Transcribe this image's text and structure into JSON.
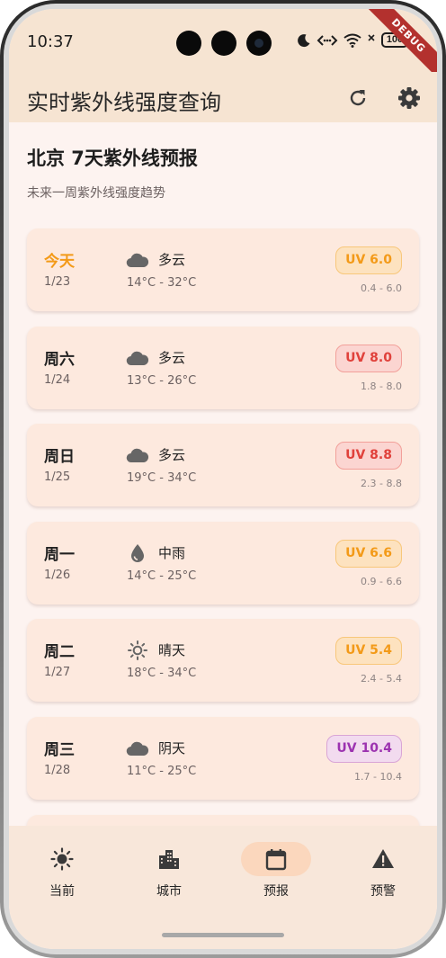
{
  "status_bar": {
    "time": "10:37",
    "battery": "100",
    "debug_label": "DEBUG"
  },
  "app_bar": {
    "title": "实时紫外线强度查询",
    "refresh_icon": "refresh-icon",
    "settings_icon": "gear-icon"
  },
  "forecast": {
    "title": "北京 7天紫外线预报",
    "subtitle": "未来一周紫外线强度趋势",
    "days": [
      {
        "day": "今天",
        "date": "1/23",
        "icon": "cloud-icon",
        "weather": "多云",
        "temp": "14°C - 32°C",
        "uv": "UV 6.0",
        "range": "0.4 - 6.0",
        "level": "high"
      },
      {
        "day": "周六",
        "date": "1/24",
        "icon": "cloud-icon",
        "weather": "多云",
        "temp": "13°C - 26°C",
        "uv": "UV 8.0",
        "range": "1.8 - 8.0",
        "level": "very-high"
      },
      {
        "day": "周日",
        "date": "1/25",
        "icon": "cloud-icon",
        "weather": "多云",
        "temp": "19°C - 34°C",
        "uv": "UV 8.8",
        "range": "2.3 - 8.8",
        "level": "very-high"
      },
      {
        "day": "周一",
        "date": "1/26",
        "icon": "rain-drop-icon",
        "weather": "中雨",
        "temp": "14°C - 25°C",
        "uv": "UV 6.6",
        "range": "0.9 - 6.6",
        "level": "high"
      },
      {
        "day": "周二",
        "date": "1/27",
        "icon": "sun-icon",
        "weather": "晴天",
        "temp": "18°C - 34°C",
        "uv": "UV 5.4",
        "range": "2.4 - 5.4",
        "level": "high"
      },
      {
        "day": "周三",
        "date": "1/28",
        "icon": "cloud-icon",
        "weather": "阴天",
        "temp": "11°C - 25°C",
        "uv": "UV 10.4",
        "range": "1.7 - 10.4",
        "level": "extreme"
      }
    ]
  },
  "bottom_nav": {
    "items": [
      {
        "label": "当前",
        "icon": "sun-icon",
        "active": false
      },
      {
        "label": "城市",
        "icon": "city-buildings-icon",
        "active": false
      },
      {
        "label": "预报",
        "icon": "calendar-icon",
        "active": true
      },
      {
        "label": "预警",
        "icon": "warning-icon",
        "active": false
      }
    ]
  },
  "colors": {
    "accent_today": "#f39a18",
    "uv_high": "#f39a18",
    "uv_very_high": "#e0413b",
    "uv_extreme": "#9c33b0",
    "app_bar_bg": "#f6e4d2",
    "card_bg": "#fde9de",
    "nav_active_bg": "#fbd7bd"
  }
}
